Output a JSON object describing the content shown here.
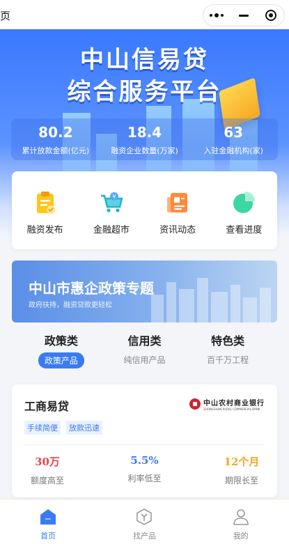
{
  "topbar": {
    "title": "页"
  },
  "hero": {
    "title_line1": "中山信易贷",
    "title_line2": "综合服务平台",
    "stats": [
      {
        "value": "80.2",
        "label": "累计放款金额(亿元)"
      },
      {
        "value": "18.4",
        "label": "融资企业数量(万家)"
      },
      {
        "value": "63",
        "label": "入驻金融机构(家)"
      }
    ]
  },
  "quick_menu": [
    {
      "label": "融资发布",
      "icon": "clipboard-icon"
    },
    {
      "label": "金融超市",
      "icon": "shopping-cart-icon"
    },
    {
      "label": "资讯动态",
      "icon": "news-icon"
    },
    {
      "label": "查看进度",
      "icon": "pie-chart-icon"
    }
  ],
  "banner": {
    "title": "中山市惠企政策专题",
    "subtitle": "政府扶持，融资贷款更轻松"
  },
  "tabs": [
    {
      "title": "政策类",
      "sub": "政策产品",
      "active": true
    },
    {
      "title": "信用类",
      "sub": "纯信用产品",
      "active": false
    },
    {
      "title": "特色类",
      "sub": "百千万工程",
      "active": false
    }
  ],
  "product": {
    "name": "工商易贷",
    "bank_name": "中山农村商业银行",
    "bank_en": "ZHONGSHAN RURAL COMMERCIAL BANK",
    "tags": [
      "手续简便",
      "放款迅速"
    ],
    "metrics": [
      {
        "value": "30万",
        "label": "额度高至",
        "color": "#e8454a"
      },
      {
        "value": "5.5%",
        "label": "利率低至",
        "color": "#3a7bf3"
      },
      {
        "value": "12个月",
        "label": "期限长至",
        "color": "#f5a623"
      }
    ]
  },
  "bottom_nav": [
    {
      "label": "首页",
      "icon": "home-icon",
      "active": true
    },
    {
      "label": "找产品",
      "icon": "product-icon",
      "active": false
    },
    {
      "label": "我的",
      "icon": "user-icon",
      "active": false
    }
  ],
  "colors": {
    "primary": "#3a7bf3",
    "red": "#e8454a",
    "orange": "#f5a623"
  }
}
